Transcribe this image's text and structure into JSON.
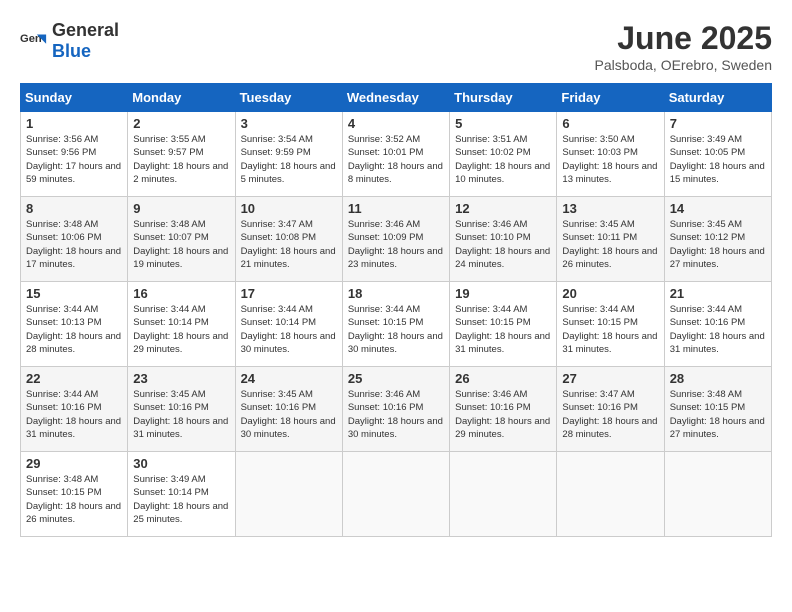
{
  "logo": {
    "general": "General",
    "blue": "Blue"
  },
  "title": "June 2025",
  "subtitle": "Palsboda, OErebro, Sweden",
  "days_header": [
    "Sunday",
    "Monday",
    "Tuesday",
    "Wednesday",
    "Thursday",
    "Friday",
    "Saturday"
  ],
  "weeks": [
    [
      {
        "day": "1",
        "sunrise": "3:56 AM",
        "sunset": "9:56 PM",
        "daylight": "17 hours and 59 minutes."
      },
      {
        "day": "2",
        "sunrise": "3:55 AM",
        "sunset": "9:57 PM",
        "daylight": "18 hours and 2 minutes."
      },
      {
        "day": "3",
        "sunrise": "3:54 AM",
        "sunset": "9:59 PM",
        "daylight": "18 hours and 5 minutes."
      },
      {
        "day": "4",
        "sunrise": "3:52 AM",
        "sunset": "10:01 PM",
        "daylight": "18 hours and 8 minutes."
      },
      {
        "day": "5",
        "sunrise": "3:51 AM",
        "sunset": "10:02 PM",
        "daylight": "18 hours and 10 minutes."
      },
      {
        "day": "6",
        "sunrise": "3:50 AM",
        "sunset": "10:03 PM",
        "daylight": "18 hours and 13 minutes."
      },
      {
        "day": "7",
        "sunrise": "3:49 AM",
        "sunset": "10:05 PM",
        "daylight": "18 hours and 15 minutes."
      }
    ],
    [
      {
        "day": "8",
        "sunrise": "3:48 AM",
        "sunset": "10:06 PM",
        "daylight": "18 hours and 17 minutes."
      },
      {
        "day": "9",
        "sunrise": "3:48 AM",
        "sunset": "10:07 PM",
        "daylight": "18 hours and 19 minutes."
      },
      {
        "day": "10",
        "sunrise": "3:47 AM",
        "sunset": "10:08 PM",
        "daylight": "18 hours and 21 minutes."
      },
      {
        "day": "11",
        "sunrise": "3:46 AM",
        "sunset": "10:09 PM",
        "daylight": "18 hours and 23 minutes."
      },
      {
        "day": "12",
        "sunrise": "3:46 AM",
        "sunset": "10:10 PM",
        "daylight": "18 hours and 24 minutes."
      },
      {
        "day": "13",
        "sunrise": "3:45 AM",
        "sunset": "10:11 PM",
        "daylight": "18 hours and 26 minutes."
      },
      {
        "day": "14",
        "sunrise": "3:45 AM",
        "sunset": "10:12 PM",
        "daylight": "18 hours and 27 minutes."
      }
    ],
    [
      {
        "day": "15",
        "sunrise": "3:44 AM",
        "sunset": "10:13 PM",
        "daylight": "18 hours and 28 minutes."
      },
      {
        "day": "16",
        "sunrise": "3:44 AM",
        "sunset": "10:14 PM",
        "daylight": "18 hours and 29 minutes."
      },
      {
        "day": "17",
        "sunrise": "3:44 AM",
        "sunset": "10:14 PM",
        "daylight": "18 hours and 30 minutes."
      },
      {
        "day": "18",
        "sunrise": "3:44 AM",
        "sunset": "10:15 PM",
        "daylight": "18 hours and 30 minutes."
      },
      {
        "day": "19",
        "sunrise": "3:44 AM",
        "sunset": "10:15 PM",
        "daylight": "18 hours and 31 minutes."
      },
      {
        "day": "20",
        "sunrise": "3:44 AM",
        "sunset": "10:15 PM",
        "daylight": "18 hours and 31 minutes."
      },
      {
        "day": "21",
        "sunrise": "3:44 AM",
        "sunset": "10:16 PM",
        "daylight": "18 hours and 31 minutes."
      }
    ],
    [
      {
        "day": "22",
        "sunrise": "3:44 AM",
        "sunset": "10:16 PM",
        "daylight": "18 hours and 31 minutes."
      },
      {
        "day": "23",
        "sunrise": "3:45 AM",
        "sunset": "10:16 PM",
        "daylight": "18 hours and 31 minutes."
      },
      {
        "day": "24",
        "sunrise": "3:45 AM",
        "sunset": "10:16 PM",
        "daylight": "18 hours and 30 minutes."
      },
      {
        "day": "25",
        "sunrise": "3:46 AM",
        "sunset": "10:16 PM",
        "daylight": "18 hours and 30 minutes."
      },
      {
        "day": "26",
        "sunrise": "3:46 AM",
        "sunset": "10:16 PM",
        "daylight": "18 hours and 29 minutes."
      },
      {
        "day": "27",
        "sunrise": "3:47 AM",
        "sunset": "10:16 PM",
        "daylight": "18 hours and 28 minutes."
      },
      {
        "day": "28",
        "sunrise": "3:48 AM",
        "sunset": "10:15 PM",
        "daylight": "18 hours and 27 minutes."
      }
    ],
    [
      {
        "day": "29",
        "sunrise": "3:48 AM",
        "sunset": "10:15 PM",
        "daylight": "18 hours and 26 minutes."
      },
      {
        "day": "30",
        "sunrise": "3:49 AM",
        "sunset": "10:14 PM",
        "daylight": "18 hours and 25 minutes."
      },
      null,
      null,
      null,
      null,
      null
    ]
  ]
}
